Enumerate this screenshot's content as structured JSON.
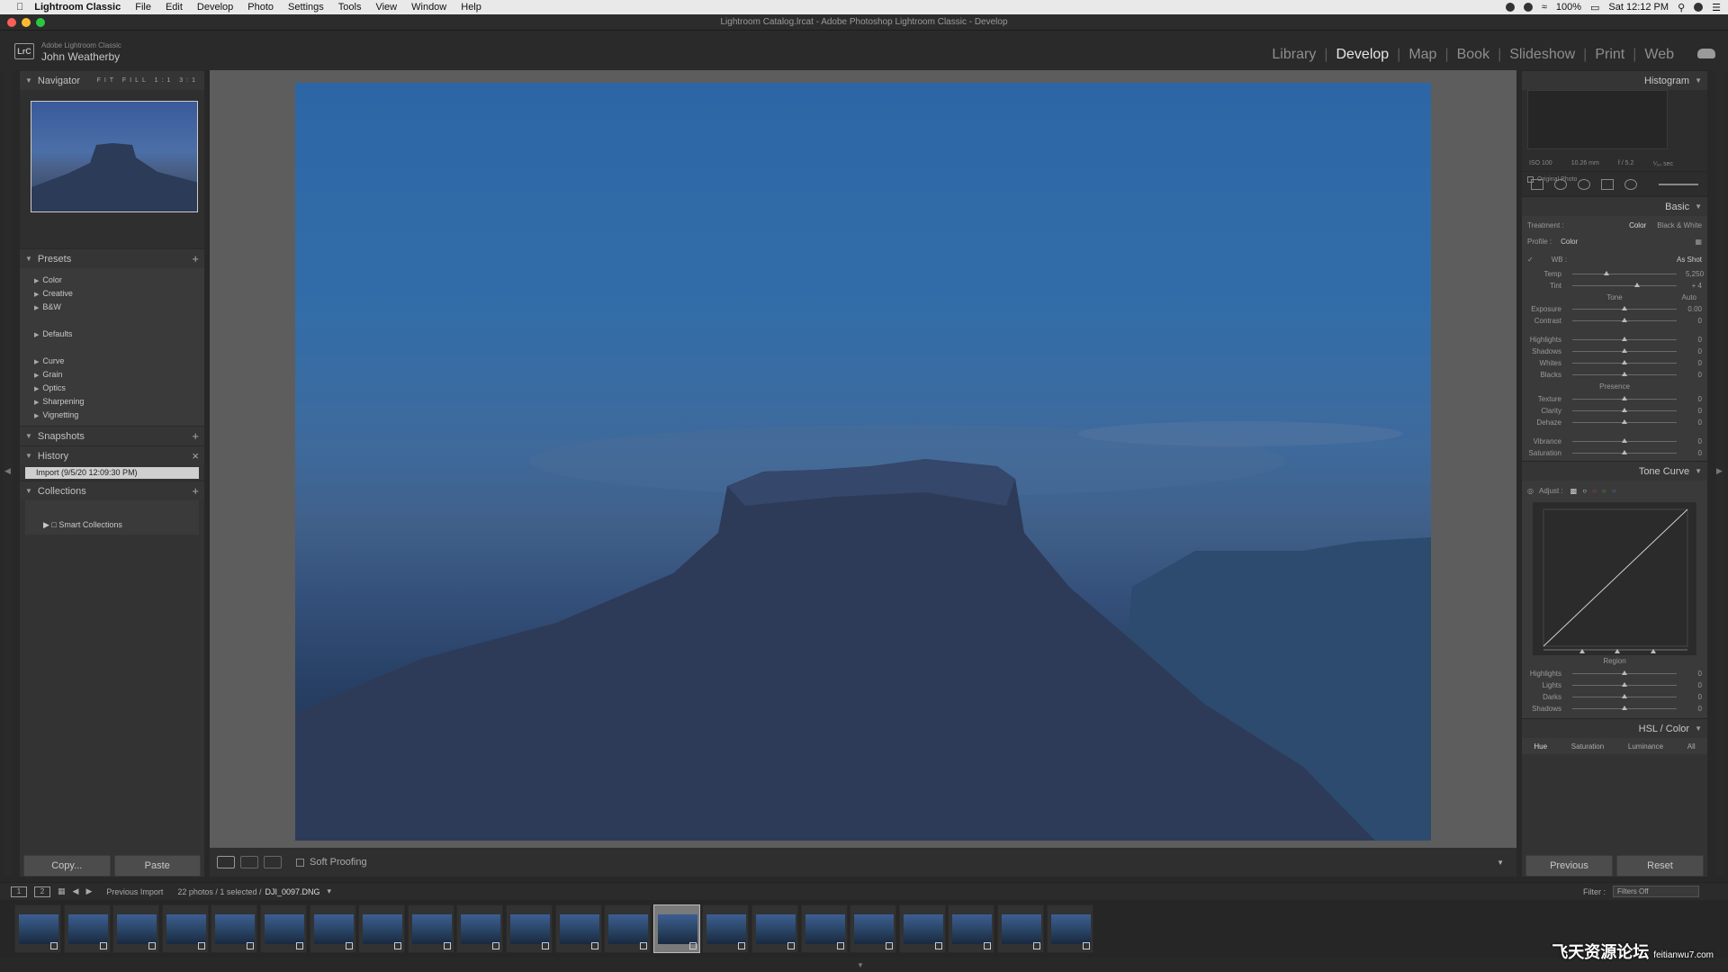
{
  "menubar": {
    "app": "Lightroom Classic",
    "items": [
      "File",
      "Edit",
      "Develop",
      "Photo",
      "Settings",
      "Tools",
      "View",
      "Window",
      "Help"
    ],
    "battery": "100%",
    "clock": "Sat 12:12 PM"
  },
  "window_title": "Lightroom Catalog.lrcat - Adobe Photoshop Lightroom Classic - Develop",
  "identity": {
    "logo": "LrC",
    "product": "Adobe Lightroom Classic",
    "user": "John Weatherby"
  },
  "modules": [
    "Library",
    "Develop",
    "Map",
    "Book",
    "Slideshow",
    "Print",
    "Web"
  ],
  "active_module": "Develop",
  "left_panel": {
    "navigator": {
      "title": "Navigator",
      "opts": "FIT FILL 1:1 3:1"
    },
    "presets": {
      "title": "Presets",
      "group1": [
        "Color",
        "Creative",
        "B&W"
      ],
      "group2": [
        "Defaults"
      ],
      "group3": [
        "Curve",
        "Grain",
        "Optics",
        "Sharpening",
        "Vignetting"
      ]
    },
    "snapshots": {
      "title": "Snapshots"
    },
    "history": {
      "title": "History",
      "item": "Import (9/5/20 12:09:30 PM)"
    },
    "collections": {
      "title": "Collections",
      "smart": "Smart Collections"
    },
    "copy_label": "Copy...",
    "paste_label": "Paste"
  },
  "toolbar": {
    "soft_proofing": "Soft Proofing"
  },
  "right_panel": {
    "histogram": {
      "title": "Histogram",
      "iso": "ISO 100",
      "focal": "10.26 mm",
      "aperture": "f / 5.2",
      "shutter": "⅟₃₀ sec",
      "original_photo": "Original Photo"
    },
    "basic": {
      "title": "Basic",
      "treatment_label": "Treatment :",
      "treatment_color": "Color",
      "treatment_bw": "Black & White",
      "profile_label": "Profile :",
      "profile_value": "Color",
      "wb_label": "WB :",
      "wb_value": "As Shot",
      "tone_label": "Tone",
      "auto_label": "Auto",
      "presence_label": "Presence",
      "sliders_wb": [
        {
          "label": "Temp",
          "value": "5,250",
          "pos": 0.33
        },
        {
          "label": "Tint",
          "value": "+ 4",
          "pos": 0.62
        }
      ],
      "sliders_tone1": [
        {
          "label": "Exposure",
          "value": "0.00",
          "pos": 0.5
        },
        {
          "label": "Contrast",
          "value": "0",
          "pos": 0.5
        }
      ],
      "sliders_tone2": [
        {
          "label": "Highlights",
          "value": "0",
          "pos": 0.5
        },
        {
          "label": "Shadows",
          "value": "0",
          "pos": 0.5
        },
        {
          "label": "Whites",
          "value": "0",
          "pos": 0.5
        },
        {
          "label": "Blacks",
          "value": "0",
          "pos": 0.5
        }
      ],
      "sliders_presence1": [
        {
          "label": "Texture",
          "value": "0",
          "pos": 0.5
        },
        {
          "label": "Clarity",
          "value": "0",
          "pos": 0.5
        },
        {
          "label": "Dehaze",
          "value": "0",
          "pos": 0.5
        }
      ],
      "sliders_presence2": [
        {
          "label": "Vibrance",
          "value": "0",
          "pos": 0.5
        },
        {
          "label": "Saturation",
          "value": "0",
          "pos": 0.5
        }
      ]
    },
    "tone_curve": {
      "title": "Tone Curve",
      "adjust": "Adjust :",
      "region": "Region",
      "sliders": [
        {
          "label": "Highlights",
          "value": "0",
          "pos": 0.5
        },
        {
          "label": "Lights",
          "value": "0",
          "pos": 0.5
        },
        {
          "label": "Darks",
          "value": "0",
          "pos": 0.5
        },
        {
          "label": "Shadows",
          "value": "0",
          "pos": 0.5
        }
      ]
    },
    "hsl": {
      "title": "HSL / Color",
      "tabs": [
        "Hue",
        "Saturation",
        "Luminance",
        "All"
      ]
    },
    "previous_label": "Previous",
    "reset_label": "Reset"
  },
  "filmstrip_bar": {
    "source": "Previous Import",
    "count": "22 photos / 1 selected /",
    "filename": "DJI_0097.DNG",
    "filter_label": "Filter :",
    "filter_value": "Filters Off"
  },
  "watermark": {
    "main": "飞天资源论坛",
    "url": "feitianwu7.com"
  },
  "colors": {
    "accent": "#e6e6e6",
    "panel": "#333333",
    "background": "#5d5d5d"
  }
}
